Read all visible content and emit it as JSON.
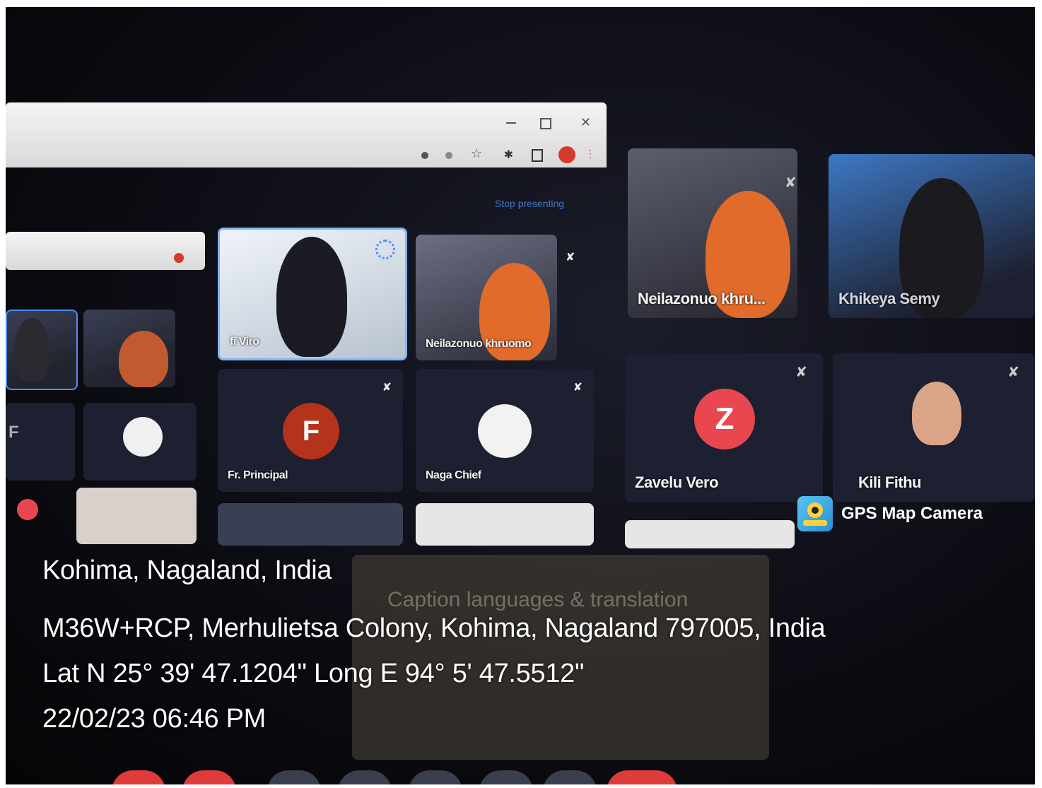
{
  "stop_presenting_label": "Stop presenting",
  "participants": [
    {
      "name": "fi Viro"
    },
    {
      "name": "Neilazonuo khruomo"
    },
    {
      "name": "Neilazonuo khru..."
    },
    {
      "name": "Khikeya Semy"
    },
    {
      "name": "Fr. Principal",
      "initial": "F"
    },
    {
      "name": "Naga Chief"
    },
    {
      "name": "Zavelu Vero",
      "initial": "Z"
    },
    {
      "name": "Kili Fithu"
    }
  ],
  "left_tile_initial": "F",
  "caption_panel_title": "Caption languages & translation",
  "gps_stamp": {
    "app_name": "GPS Map Camera",
    "place": "Kohima, Nagaland, India",
    "address": "M36W+RCP, Merhulietsa Colony, Kohima, Nagaland 797005, India",
    "coordinates": "Lat N 25° 39' 47.1204\" Long E 94° 5' 47.5512\"",
    "datetime": "22/02/23 06:46 PM"
  },
  "colors": {
    "avatar_f": "#b5331b",
    "avatar_z": "#e8474f",
    "accent_blue": "#4f8ff0"
  }
}
